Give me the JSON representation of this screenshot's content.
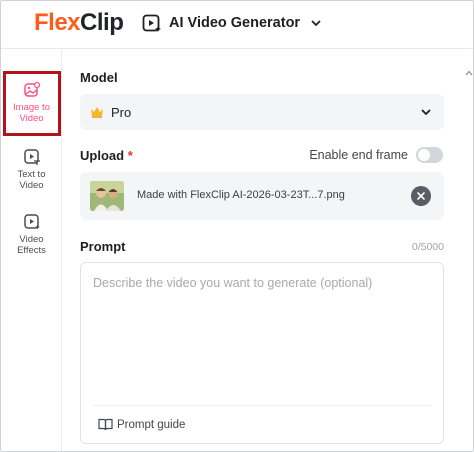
{
  "header": {
    "logo_flex": "Flex",
    "logo_clip": "Clip",
    "product_title": "AI Video Generator"
  },
  "sidebar": {
    "items": [
      {
        "line1": "Image to",
        "line2": "Video",
        "active": true,
        "icon": "image-to-video-icon"
      },
      {
        "line1": "Text to",
        "line2": "Video",
        "active": false,
        "icon": "text-to-video-icon"
      },
      {
        "line1": "Video",
        "line2": "Effects",
        "active": false,
        "icon": "video-effects-icon"
      }
    ]
  },
  "model": {
    "label": "Model",
    "value": "Pro"
  },
  "upload": {
    "label": "Upload",
    "required_mark": "*",
    "end_frame_label": "Enable end frame",
    "end_frame_enabled": false,
    "file_name": "Made with FlexClip AI-2026-03-23T...7.png"
  },
  "prompt": {
    "label": "Prompt",
    "count": "0/5000",
    "placeholder": "Describe the video you want to generate (optional)",
    "guide_label": "Prompt guide"
  },
  "colors": {
    "brand_orange": "#ff5c1a",
    "active_pink": "#ff4f80",
    "highlight_red": "#b0151c",
    "required_red": "#e0352b"
  }
}
